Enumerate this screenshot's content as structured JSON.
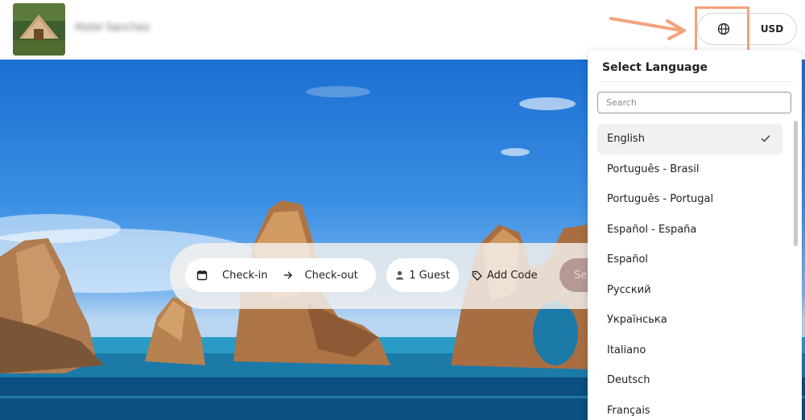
{
  "header": {
    "hotel_name": "Hotel Sanchez",
    "logo_alt": "hotel tent logo",
    "language_icon": "globe-icon",
    "currency_label": "USD"
  },
  "search_bar": {
    "checkin_label": "Check-in",
    "checkout_label": "Check-out",
    "guests_label": "1 Guest",
    "code_label": "Add Code",
    "search_label": "Search",
    "calendar_icon": "calendar-icon",
    "arrow_icon": "arrow-right-icon",
    "guest_icon": "person-icon",
    "tag_icon": "tag-icon"
  },
  "language_dropdown": {
    "title": "Select Language",
    "search_placeholder": "Search",
    "selected": "English",
    "items": [
      {
        "label": "English"
      },
      {
        "label": "Português - Brasil"
      },
      {
        "label": "Português - Portugal"
      },
      {
        "label": "Español - España"
      },
      {
        "label": "Español"
      },
      {
        "label": "Русский"
      },
      {
        "label": "Українська"
      },
      {
        "label": "Italiano"
      },
      {
        "label": "Deutsch"
      },
      {
        "label": "Français"
      }
    ]
  },
  "colors": {
    "highlight": "#f4a27c",
    "search_button": "#b49a93"
  }
}
